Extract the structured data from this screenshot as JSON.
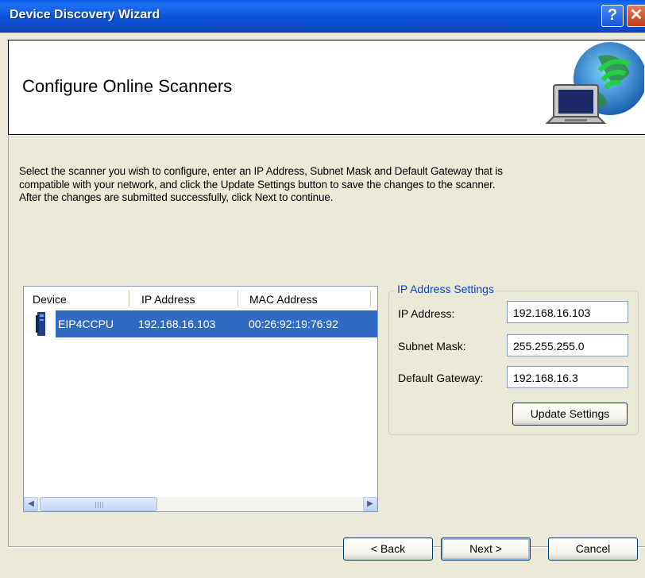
{
  "window": {
    "title": "Device Discovery Wizard",
    "help_glyph": "?",
    "close_glyph": "✕"
  },
  "header": {
    "title": "Configure Online Scanners",
    "icon": "laptop-network-icon"
  },
  "description": "Select the scanner you wish to configure, enter an IP Address, Subnet Mask and Default Gateway that is\ncompatible with your network, and click the Update Settings button to save the changes to the scanner.\nAfter the changes are submitted successfully, click Next to continue.",
  "device_list": {
    "columns": [
      "Device",
      "IP Address",
      "MAC Address"
    ],
    "rows": [
      {
        "device": "EIP4CCPU",
        "ip": "192.168.16.103",
        "mac": "00:26:92:19:76:92",
        "selected": true
      }
    ],
    "scroll_left": "◀",
    "scroll_right": "▶"
  },
  "ip_settings": {
    "group_title": "IP Address Settings",
    "ip_label": "IP Address:",
    "ip_value": "192.168.16.103",
    "subnet_label": "Subnet Mask:",
    "subnet_value": "255.255.255.0",
    "gateway_label": "Default Gateway:",
    "gateway_value": "192.168.16.3",
    "update_button": "Update Settings"
  },
  "nav": {
    "back": "< Back",
    "next": "Next >",
    "cancel": "Cancel"
  },
  "colors": {
    "titlebar": "#0a5de8",
    "selection": "#316ac5",
    "dialog_bg": "#ece9d8",
    "group_title": "#0046d5"
  }
}
